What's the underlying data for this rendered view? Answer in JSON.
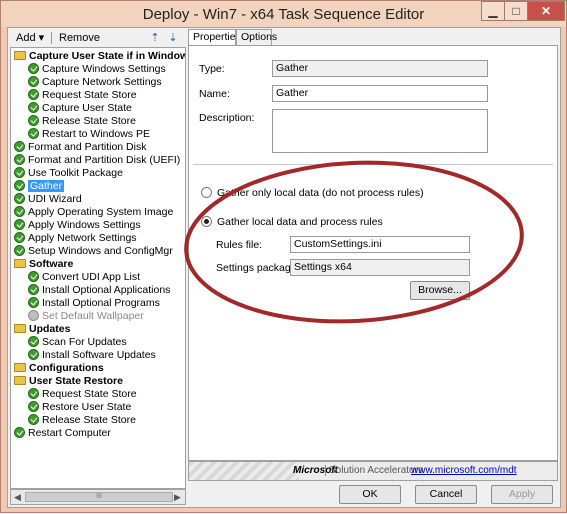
{
  "window": {
    "title": "Deploy - Win7 - x64 Task Sequence Editor",
    "minimize_glyph": "▁",
    "maximize_glyph": "□",
    "close_glyph": "✕"
  },
  "toolbar": {
    "add_label": "Add ▾",
    "remove_label": "Remove",
    "move_up_icon": "move-up-icon",
    "move_down_icon": "move-down-icon"
  },
  "tree": {
    "items": [
      {
        "label": "Capture User State if in Window",
        "type": "group",
        "icon": "folder-icon",
        "indent": 0
      },
      {
        "label": "Capture Windows Settings",
        "type": "step",
        "icon": "check-icon",
        "indent": 1
      },
      {
        "label": "Capture Network Settings",
        "type": "step",
        "icon": "check-icon",
        "indent": 1
      },
      {
        "label": "Request State Store",
        "type": "step",
        "icon": "check-icon",
        "indent": 1
      },
      {
        "label": "Capture User State",
        "type": "step",
        "icon": "check-icon",
        "indent": 1
      },
      {
        "label": "Release State Store",
        "type": "step",
        "icon": "check-icon",
        "indent": 1
      },
      {
        "label": "Restart to Windows PE",
        "type": "step",
        "icon": "check-icon",
        "indent": 1
      },
      {
        "label": "Format and Partition Disk",
        "type": "step",
        "icon": "check-icon",
        "indent": 0
      },
      {
        "label": "Format and Partition Disk (UEFI)",
        "type": "step",
        "icon": "check-icon",
        "indent": 0
      },
      {
        "label": "Use Toolkit Package",
        "type": "step",
        "icon": "check-icon",
        "indent": 0
      },
      {
        "label": "Gather",
        "type": "step",
        "icon": "check-icon",
        "indent": 0,
        "selected": true
      },
      {
        "label": "UDI Wizard",
        "type": "step",
        "icon": "check-icon",
        "indent": 0
      },
      {
        "label": "Apply Operating System Image",
        "type": "step",
        "icon": "check-icon",
        "indent": 0
      },
      {
        "label": "Apply Windows Settings",
        "type": "step",
        "icon": "check-icon",
        "indent": 0
      },
      {
        "label": "Apply Network Settings",
        "type": "step",
        "icon": "check-icon",
        "indent": 0
      },
      {
        "label": "Setup Windows and ConfigMgr",
        "type": "step",
        "icon": "check-icon",
        "indent": 0
      },
      {
        "label": "Software",
        "type": "group",
        "icon": "folder-icon",
        "indent": 0
      },
      {
        "label": "Convert UDI App List",
        "type": "step",
        "icon": "check-icon",
        "indent": 1
      },
      {
        "label": "Install Optional Applications",
        "type": "step",
        "icon": "check-icon",
        "indent": 1
      },
      {
        "label": "Install Optional Programs",
        "type": "step",
        "icon": "check-icon",
        "indent": 1
      },
      {
        "label": "Set Default Wallpaper",
        "type": "step",
        "icon": "disabled-icon",
        "indent": 1,
        "disabled": true
      },
      {
        "label": "Updates",
        "type": "group",
        "icon": "folder-icon",
        "indent": 0
      },
      {
        "label": "Scan For Updates",
        "type": "step",
        "icon": "check-icon",
        "indent": 1
      },
      {
        "label": "Install Software Updates",
        "type": "step",
        "icon": "check-icon",
        "indent": 1
      },
      {
        "label": "Configurations",
        "type": "group",
        "icon": "folder-icon",
        "indent": 0
      },
      {
        "label": "User State Restore",
        "type": "group",
        "icon": "folder-icon",
        "indent": 0
      },
      {
        "label": "Request State Store",
        "type": "step",
        "icon": "check-icon",
        "indent": 1
      },
      {
        "label": "Restore User State",
        "type": "step",
        "icon": "check-icon",
        "indent": 1
      },
      {
        "label": "Release State Store",
        "type": "step",
        "icon": "check-icon",
        "indent": 1
      },
      {
        "label": "Restart Computer",
        "type": "step",
        "icon": "check-icon",
        "indent": 0
      }
    ]
  },
  "tabs": {
    "properties": "Properties",
    "options": "Options"
  },
  "properties": {
    "type_label": "Type:",
    "type_value": "Gather",
    "name_label": "Name:",
    "name_value": "Gather",
    "description_label": "Description:",
    "description_value": "",
    "radio_local_only": "Gather only local data (do not process rules)",
    "radio_process_rules": "Gather local data and process rules",
    "rules_file_label": "Rules file:",
    "rules_file_value": "CustomSettings.ini",
    "settings_package_label": "Settings package:",
    "settings_package_value": "Settings x64",
    "browse_label": "Browse..."
  },
  "banner": {
    "microsoft": "Microsoft",
    "solution_accelerators": "Solution Accelerators",
    "link": "www.microsoft.com/mdt"
  },
  "buttons": {
    "ok": "OK",
    "cancel": "Cancel",
    "apply": "Apply"
  },
  "colors": {
    "window_frame": "#f0c9b0",
    "selection": "#3399ff",
    "annotation": "#a3282a",
    "step_ok": "#3e9d2c"
  }
}
